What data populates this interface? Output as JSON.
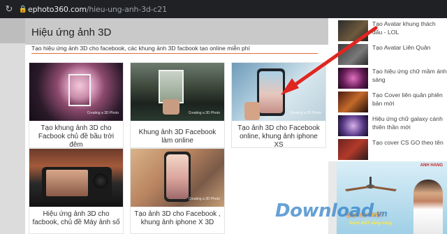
{
  "browser": {
    "url_host": "ephoto360.com",
    "url_path": "/hieu-ung-anh-3d-c21"
  },
  "main": {
    "title": "Hiệu ứng ảnh 3D",
    "description": "Tạo hiệu ứng ảnh 3D cho facebook, các khung ảnh 3D facbook tạo online miễn phí",
    "cards": [
      {
        "caption": "Tạo khung ảnh 3D cho Facbook chủ đề bầu trời đêm",
        "badge": "Creating a 3D Photo"
      },
      {
        "caption": "Khung ảnh 3D Facebook làm online",
        "badge": "Creating a 3D Photo"
      },
      {
        "caption": "Tạo ảnh 3D cho Facebook online, khung ảnh iphone XS",
        "badge": "Creating a 3D Photo"
      },
      {
        "caption": "Hiệu ứng ảnh 3D cho facbook, chủ đề Máy ảnh số",
        "badge": ""
      },
      {
        "caption": "Tạo ảnh 3D cho Facebook , khung ảnh iphone X 3D",
        "badge": "Creating a 3D Photo"
      }
    ]
  },
  "sidebar": {
    "items": [
      {
        "label": "Tạo Avatar khung thách đấu - LOL",
        "icon": "lol-thumb"
      },
      {
        "label": "Tạo Avatar Liên Quân",
        "icon": "lienquan-thumb"
      },
      {
        "label": "Tạo hiệu ứng chữ mầm ánh sáng",
        "icon": "light-text-thumb"
      },
      {
        "label": "Tạo Cover liên quân phiên bản mới",
        "icon": "cover-thumb"
      },
      {
        "label": "Hiệu ứng chữ galaxy cánh thiên thần mới",
        "icon": "galaxy-thumb"
      },
      {
        "label": "Tạo cover CS GO theo tên",
        "icon": "csgo-thumb"
      }
    ]
  },
  "ad": {
    "brand": "ANH HANG",
    "promo_line1": "Quạt trần NHẬT",
    "promo_line2": "Đánh BẬT nắng nóng"
  },
  "watermark": {
    "text": "Download",
    "suffix": ".vn"
  },
  "colors": {
    "accent": "#e66a35",
    "arrow": "#e0261f"
  }
}
